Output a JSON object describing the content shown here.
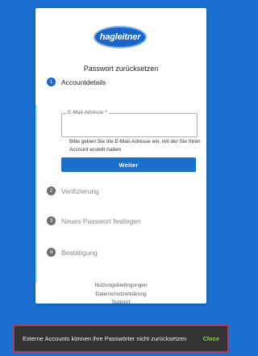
{
  "logo": {
    "text": "hagleitner"
  },
  "page": {
    "title": "Passwort zurücksetzen"
  },
  "steps": [
    {
      "number": "1",
      "label": "Accountdetails"
    },
    {
      "number": "2",
      "label": "Verifizierung"
    },
    {
      "number": "3",
      "label": "Neues Passwort festlegen"
    },
    {
      "number": "4",
      "label": "Bestätigung"
    }
  ],
  "email": {
    "label": "E-Mail-Adresse *",
    "value": "",
    "hint": "Bitte geben Sie die E-Mail-Adresse ein, mit der Sie Ihren Account erstellt haben"
  },
  "actions": {
    "continue_label": "Weiter"
  },
  "footer_links": [
    "Nutzungsbedingungen",
    "Datenschutzerklärung",
    "Support"
  ],
  "snackbar": {
    "message": "Externe Accounts können ihre Passwörter nicht zurücksetzen",
    "close_label": "Close"
  },
  "colors": {
    "background": "#1a6fd0",
    "accent": "#1a66c8",
    "snackbar_close": "#8fd14f"
  }
}
